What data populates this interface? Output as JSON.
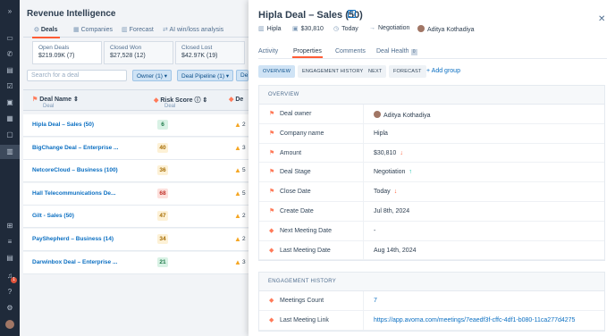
{
  "leftnav": {
    "icons": [
      "expand-icon",
      "calendar-icon",
      "phone-icon",
      "inbox-icon",
      "check-icon",
      "doc-icon",
      "rocket-icon",
      "chat-icon",
      "deals-icon",
      "chart-icon",
      "grid-icon",
      "list-icon",
      "box-icon",
      "bell-icon",
      "help-icon",
      "settings-icon",
      "avatar"
    ],
    "notification_count": "1"
  },
  "background": {
    "title": "Revenue Intelligence",
    "tabs": [
      "Deals",
      "Companies",
      "Forecast",
      "AI win/loss analysis"
    ],
    "cards": [
      {
        "label": "Open Deals",
        "value": "$219.09K (7)"
      },
      {
        "label": "Closed Won",
        "value": "$27,528 (12)"
      },
      {
        "label": "Closed Lost",
        "value": "$42.97K (19)"
      }
    ],
    "search_placeholder": "Search for a deal",
    "filters": [
      "Owner (1)",
      "Deal Pipeline (1)",
      "De"
    ],
    "columns": [
      {
        "header": "Deal Name",
        "sub": "Deal"
      },
      {
        "header": "Risk Score",
        "sub": "Deal"
      },
      {
        "header": "De",
        "sub": ""
      }
    ],
    "rows": [
      {
        "name": "Hipla Deal – Sales (50)",
        "risk": "6",
        "risk_color": "#d9f2e5",
        "risk_text": "#1f7a4a",
        "warn": "2"
      },
      {
        "name": "BigChange Deal – Enterprise ...",
        "risk": "40",
        "risk_color": "#fdf1d6",
        "risk_text": "#a56b00",
        "warn": "3"
      },
      {
        "name": "NetcoreCloud – Business (100)",
        "risk": "36",
        "risk_color": "#fdf1d6",
        "risk_text": "#a56b00",
        "warn": "5"
      },
      {
        "name": "Hall Telecommunications De...",
        "risk": "68",
        "risk_color": "#fde0dc",
        "risk_text": "#c0322b",
        "warn": "5"
      },
      {
        "name": "Gilt - Sales (50)",
        "risk": "47",
        "risk_color": "#fdf1d6",
        "risk_text": "#a56b00",
        "warn": "2"
      },
      {
        "name": "PayShepherd – Business (14)",
        "risk": "34",
        "risk_color": "#fdf1d6",
        "risk_text": "#a56b00",
        "warn": "2"
      },
      {
        "name": "Darwinbox Deal – Enterprise ...",
        "risk": "21",
        "risk_color": "#d9f2e5",
        "risk_text": "#1f7a4a",
        "warn": "3"
      }
    ]
  },
  "panel": {
    "title": "Hipla Deal – Sales (50)",
    "meta": {
      "company": "Hipla",
      "amount": "$30,810",
      "date": "Today",
      "stage": "Negotiation",
      "owner": "Aditya Kothadiya"
    },
    "tabs": [
      "Activity",
      "Properties",
      "Comments",
      "Deal Health"
    ],
    "deal_health_badge": "0",
    "groups": [
      "OVERVIEW",
      "ENGAGEMENT HISTORY",
      "NEXT",
      "FORECAST"
    ],
    "add_group": "Add group",
    "overview": {
      "heading": "OVERVIEW",
      "rows": [
        {
          "label": "Deal owner",
          "value": "Aditya Kothadiya"
        },
        {
          "label": "Company name",
          "value": "Hipla"
        },
        {
          "label": "Amount",
          "value": "$30,810"
        },
        {
          "label": "Deal Stage",
          "value": "Negotiation"
        },
        {
          "label": "Close Date",
          "value": "Today"
        },
        {
          "label": "Create Date",
          "value": "Jul 8th, 2024"
        },
        {
          "label": "Next Meeting Date",
          "value": "-"
        },
        {
          "label": "Last Meeting Date",
          "value": "Aug 14th, 2024"
        }
      ]
    },
    "engagement": {
      "heading": "ENGAGEMENT HISTORY",
      "rows": [
        {
          "label": "Meetings Count",
          "value": "7"
        },
        {
          "label": "Last Meeting Link",
          "value": "https://app.avoma.com/meetings/7eaedf3f-cffc-4df1-b080-11ca277d4275"
        }
      ]
    }
  }
}
